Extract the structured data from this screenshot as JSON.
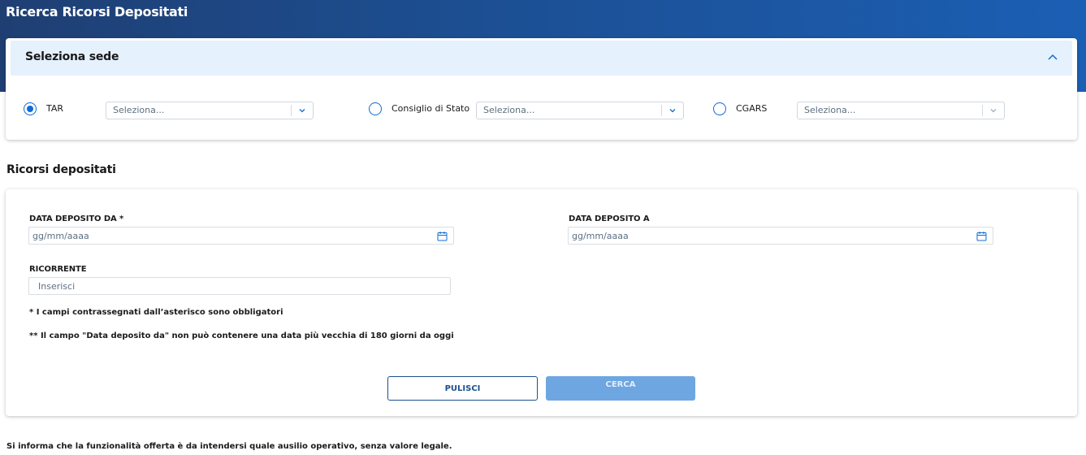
{
  "page": {
    "title": "Ricerca Ricorsi Depositati"
  },
  "sede": {
    "title": "Seleziona sede",
    "options": [
      {
        "label": "TAR",
        "checked": true,
        "select_placeholder": "Seleziona..."
      },
      {
        "label": "Consiglio di Stato",
        "checked": false,
        "select_placeholder": "Seleziona..."
      },
      {
        "label": "CGARS",
        "checked": false,
        "select_placeholder": "Seleziona..."
      }
    ]
  },
  "ricorsi": {
    "heading": "Ricorsi depositati",
    "data_da": {
      "label": "DATA DEPOSITO DA *",
      "placeholder": "gg/mm/aaaa"
    },
    "data_a": {
      "label": "DATA DEPOSITO A",
      "placeholder": "gg/mm/aaaa"
    },
    "ricorrente": {
      "label": "RICORRENTE",
      "placeholder": "Inserisci"
    },
    "note_required": "* I campi contrassegnati dall’asterisco sono obbligatori",
    "note_limit": "** Il campo \"Data deposito da\" non può contenere una data più vecchia di 180 giorni da oggi",
    "buttons": {
      "clear": "PULISCI",
      "search": "CERCA"
    }
  },
  "footer": {
    "disclaimer": "Si informa che la funzionalità offerta è da intendersi quale ausilio operativo, senza valore legale."
  },
  "colors": {
    "primary": "#0f6bd7",
    "header_gradient_start": "#1f3f73",
    "header_gradient_end": "#1b5fb4",
    "panel_header": "#e5f1fc",
    "button_disabled": "#6ea6e2"
  },
  "icons": [
    "chevron-up-icon",
    "chevron-down-icon",
    "calendar-icon"
  ]
}
